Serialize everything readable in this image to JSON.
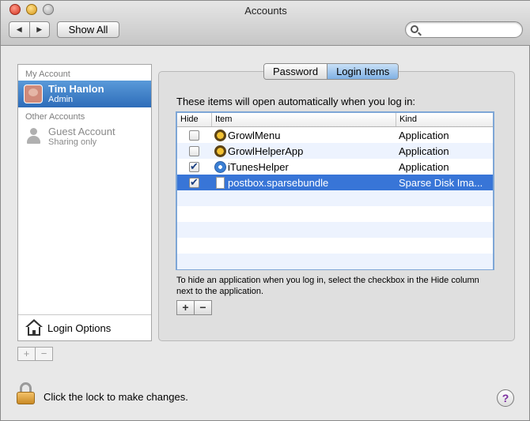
{
  "window": {
    "title": "Accounts"
  },
  "toolbar": {
    "back": "◀",
    "forward": "▶",
    "show_all": "Show All",
    "search_placeholder": ""
  },
  "sidebar": {
    "my_account_header": "My Account",
    "current_user": {
      "name": "Tim Hanlon",
      "role": "Admin"
    },
    "other_accounts_header": "Other Accounts",
    "guest": {
      "name": "Guest Account",
      "role": "Sharing only"
    },
    "login_options": "Login Options",
    "add": "+",
    "remove": "−"
  },
  "tabs": [
    {
      "label": "Password"
    },
    {
      "label": "Login Items"
    }
  ],
  "login_items": {
    "intro": "These items will open automatically when you log in:",
    "columns": {
      "hide": "Hide",
      "item": "Item",
      "kind": "Kind"
    },
    "rows": [
      {
        "hide": false,
        "icon": "growl-icon",
        "item": "GrowlMenu",
        "kind": "Application"
      },
      {
        "hide": false,
        "icon": "growl-icon",
        "item": "GrowlHelperApp",
        "kind": "Application"
      },
      {
        "hide": true,
        "icon": "itunes-icon",
        "item": "iTunesHelper",
        "kind": "Application"
      },
      {
        "hide": true,
        "icon": "document-icon",
        "item": "postbox.sparsebundle",
        "kind": "Sparse Disk Ima..."
      }
    ],
    "hint": "To hide an application when you log in, select the checkbox in the Hide column next to the application.",
    "add": "+",
    "remove": "−"
  },
  "footer": {
    "lock_text": "Click the lock to make changes.",
    "help": "?"
  }
}
